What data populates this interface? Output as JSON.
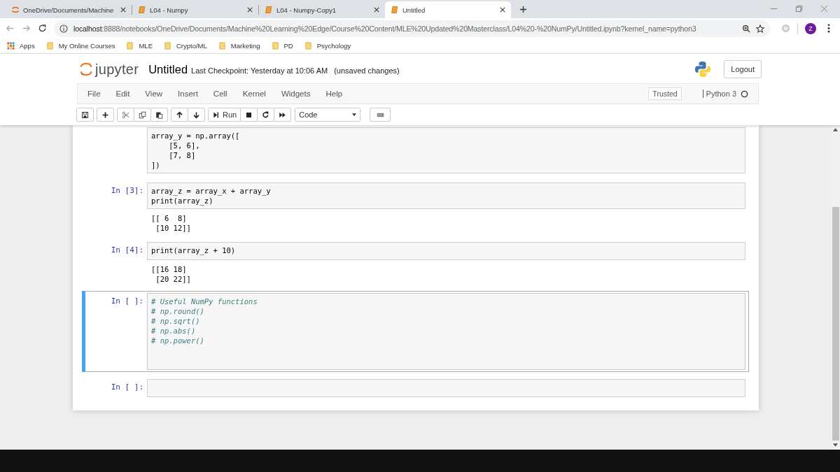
{
  "browser": {
    "tabs": [
      {
        "title": "OneDrive/Documents/Machine",
        "kind": "jupyter",
        "selected": false
      },
      {
        "title": "L04 - Numpy",
        "kind": "notebook",
        "selected": false
      },
      {
        "title": "L04 - Numpy-Copy1",
        "kind": "notebook",
        "selected": false
      },
      {
        "title": "Untitled",
        "kind": "notebook",
        "selected": true
      }
    ],
    "url_host": "localhost",
    "url_rest": ":8888/notebooks/OneDrive/Documents/Machine%20Learning%20Edge/Course%20Content/MLE%20Updated%20Masterclass/L04%20-%20NumPy/Untitled.ipynb?kernel_name=python3",
    "avatar_letter": "Z",
    "bookmarks": [
      {
        "label": "Apps",
        "kind": "apps"
      },
      {
        "label": "My Online Courses",
        "kind": "folder"
      },
      {
        "label": "MLE",
        "kind": "folder"
      },
      {
        "label": "Crypto/ML",
        "kind": "folder"
      },
      {
        "label": "Marketing",
        "kind": "folder"
      },
      {
        "label": "PD",
        "kind": "folder"
      },
      {
        "label": "Psychology",
        "kind": "folder"
      }
    ]
  },
  "header": {
    "logo_text": "jupyter",
    "notebook_name": "Untitled",
    "checkpoint": "Last Checkpoint: Yesterday at 10:06 AM",
    "save_status": "(unsaved changes)",
    "logout": "Logout"
  },
  "menu": [
    "File",
    "Edit",
    "View",
    "Insert",
    "Cell",
    "Kernel",
    "Widgets",
    "Help"
  ],
  "trusted": "Trusted",
  "kernel_name": "Python 3",
  "toolbar": [
    {
      "group": [
        {
          "kind": "save"
        }
      ]
    },
    {
      "group": [
        {
          "kind": "add"
        }
      ]
    },
    {
      "group": [
        {
          "kind": "cut"
        },
        {
          "kind": "copy"
        },
        {
          "kind": "paste"
        }
      ]
    },
    {
      "group": [
        {
          "kind": "up"
        },
        {
          "kind": "down"
        }
      ]
    },
    {
      "group": [
        {
          "kind": "run",
          "label": "Run"
        },
        {
          "kind": "stop"
        },
        {
          "kind": "restart"
        },
        {
          "kind": "fastforward"
        }
      ]
    }
  ],
  "cell_type": "Code",
  "cells": [
    {
      "selected": false,
      "kind": "code",
      "lines": [
        "array_y = np.array([",
        "    [5, 6],",
        "    [7, 8]",
        "])"
      ]
    },
    {
      "prompt": "In [3]:",
      "selected": false,
      "kind": "code",
      "lines": [
        "array_z = array_x + array_y",
        "print(array_z)"
      ],
      "output": [
        "[[ 6  8]",
        " [10 12]]"
      ]
    },
    {
      "prompt": "In [4]:",
      "selected": false,
      "kind": "code",
      "lines": [
        "print(array_z + 10)"
      ],
      "output": [
        "[[16 18]",
        " [20 22]]"
      ]
    },
    {
      "prompt": "In [ ]:",
      "selected": true,
      "kind": "comment",
      "lines": [
        "# Useful NumPy functions",
        "# np.round()",
        "# np.sqrt()",
        "# np.abs()",
        "# np.power()"
      ]
    },
    {
      "prompt": "In [ ]:",
      "selected": false,
      "kind": "code"
    }
  ]
}
